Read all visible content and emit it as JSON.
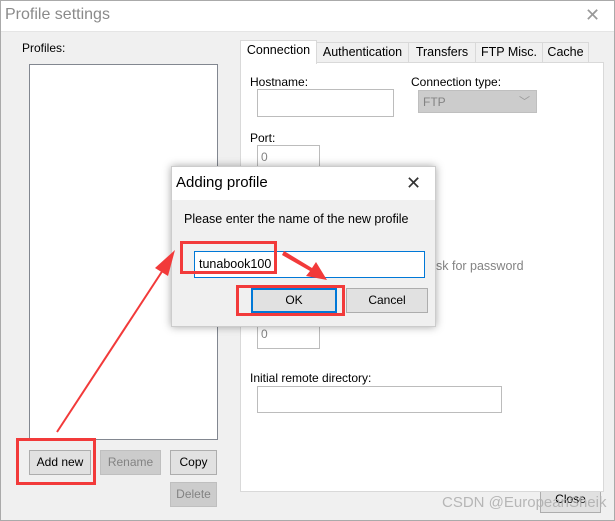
{
  "window": {
    "title": "Profile settings",
    "close_icon": "close-icon"
  },
  "profiles": {
    "label": "Profiles:",
    "items": []
  },
  "buttons": {
    "add_new": "Add new",
    "rename": "Rename",
    "copy": "Copy",
    "delete": "Delete",
    "close": "Close"
  },
  "tabs": [
    {
      "label": "Connection",
      "active": true
    },
    {
      "label": "Authentication"
    },
    {
      "label": "Transfers"
    },
    {
      "label": "FTP Misc."
    },
    {
      "label": "Cache"
    }
  ],
  "connection": {
    "hostname_label": "Hostname:",
    "hostname_value": "",
    "connection_type_label": "Connection type:",
    "connection_type_value": "FTP",
    "port_label": "Port:",
    "port_value": "0",
    "ask_password_partial": "sk for password",
    "second_value": "0",
    "remote_dir_label": "Initial remote directory:",
    "remote_dir_value": ""
  },
  "dialog": {
    "title": "Adding profile",
    "prompt": "Please enter the name of the new profile",
    "input_value": "tunabook100",
    "ok": "OK",
    "cancel": "Cancel"
  },
  "annotation": {
    "color": "#f23a3a"
  },
  "watermark": "CSDN @EuropeanSheik"
}
